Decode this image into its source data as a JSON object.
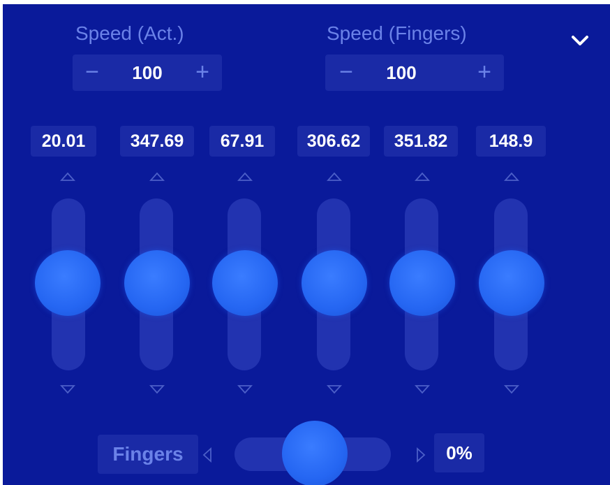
{
  "speed_act": {
    "label": "Speed (Act.)",
    "minus": "−",
    "value": "100",
    "plus": "+"
  },
  "speed_fingers": {
    "label": "Speed (Fingers)",
    "minus": "−",
    "value": "100",
    "plus": "+"
  },
  "joints": [
    {
      "value": "20.01"
    },
    {
      "value": "347.69"
    },
    {
      "value": "67.91"
    },
    {
      "value": "306.62"
    },
    {
      "value": "351.82"
    },
    {
      "value": "148.9"
    }
  ],
  "fingers": {
    "label": "Fingers",
    "percent": "0%"
  },
  "icons": {
    "collapse": "chevron-down-icon",
    "up": "triangle-up-icon",
    "down": "triangle-down-icon",
    "left": "triangle-left-icon",
    "right": "triangle-right-icon"
  },
  "colors": {
    "background": "#0a1a9a",
    "field": "#1a2aa6",
    "track": "#2233b0",
    "knob": "#2566f2",
    "muted_text": "#6b82e8",
    "value_text": "#ffffff"
  }
}
